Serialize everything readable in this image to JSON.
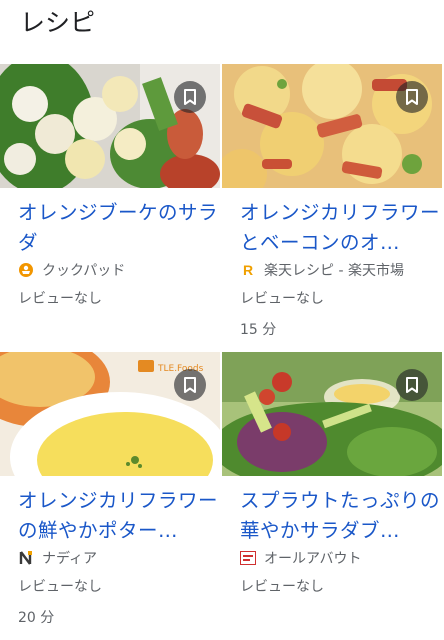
{
  "section": {
    "title": "レシピ"
  },
  "recipes": [
    {
      "title": "オレンジブーケのサラダ",
      "source": "クックパッド",
      "source_icon": "cookpad-logo",
      "reviews": "レビューなし",
      "time": ""
    },
    {
      "title": "オレンジカリフラワーとベーコンのオ…",
      "source": "楽天レシピ - 楽天市場",
      "source_icon": "rakuten-logo",
      "reviews": "レビューなし",
      "time": "15 分"
    },
    {
      "title": "オレンジカリフラワーの鮮やかポター…",
      "source": "ナディア",
      "source_icon": "nadia-logo",
      "reviews": "レビューなし",
      "time": "20 分"
    },
    {
      "title": "スプラウトたっぷりの華やかサラダブ…",
      "source": "オールアバウト",
      "source_icon": "allabout-logo",
      "reviews": "レビューなし",
      "time": ""
    }
  ],
  "colors": {
    "link": "#1a57c8",
    "secondary": "#5f6368",
    "bookmark_bg": "#202124"
  }
}
